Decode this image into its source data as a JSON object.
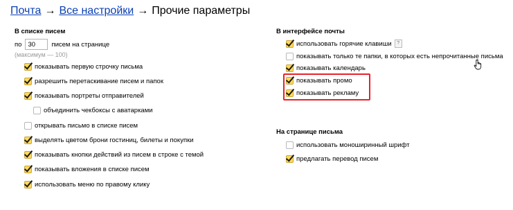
{
  "breadcrumb": {
    "mail": "Почта",
    "all_settings": "Все настройки",
    "current": "Прочие параметры",
    "separator": "→"
  },
  "left_section": {
    "title": "В списке писем",
    "per_page_prefix": "по",
    "per_page_value": "30",
    "per_page_suffix": "писем на странице",
    "per_page_hint": "(максимум — 100)",
    "options": [
      {
        "label": "показывать первую строчку письма",
        "checked": true
      },
      {
        "label": "разрешить перетаскивание писем и папок",
        "checked": true
      },
      {
        "label": "показывать портреты отправителей",
        "checked": true
      },
      {
        "label": "объединить чекбоксы с аватарками",
        "checked": false
      },
      {
        "label": "открывать письмо в списке писем",
        "checked": false
      },
      {
        "label": "выделять цветом брони гостиниц, билеты и покупки",
        "checked": true
      },
      {
        "label": "показывать кнопки действий из писем в строке с темой",
        "checked": true
      },
      {
        "label": "показывать вложения в списке писем",
        "checked": true
      },
      {
        "label": "использовать меню по правому клику",
        "checked": true
      }
    ]
  },
  "right_section": {
    "title": "В интерфейсе почты",
    "options": [
      {
        "label": "использовать горячие клавиши",
        "checked": true,
        "help": "?"
      },
      {
        "label": "показывать только те папки, в которых есть непрочитанные письма",
        "checked": false
      },
      {
        "label": "показывать календарь",
        "checked": true
      },
      {
        "label": "показывать промо",
        "checked": true
      },
      {
        "label": "показывать рекламу",
        "checked": true
      }
    ]
  },
  "letter_section": {
    "title": "На странице письма",
    "options": [
      {
        "label": "использовать моноширинный шрифт",
        "checked": false
      },
      {
        "label": "предлагать перевод писем",
        "checked": true
      }
    ]
  },
  "icons": {
    "cursor": "hand-pointer-icon",
    "help": "help-icon"
  },
  "colors": {
    "link": "#0a3fb4",
    "checkbox_checked": "#ffd95a",
    "highlight": "#e8202a"
  }
}
